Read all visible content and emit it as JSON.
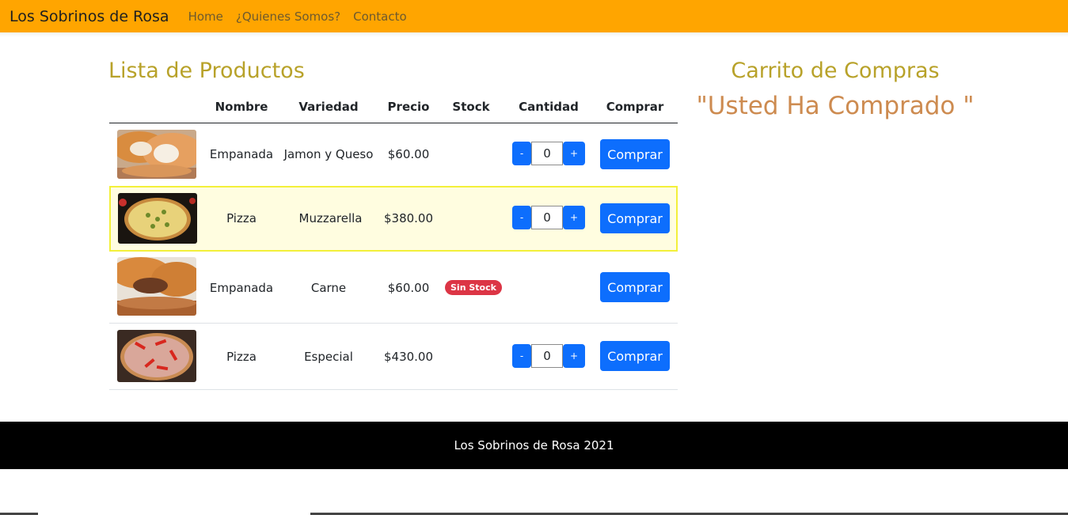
{
  "navbar": {
    "brand": "Los Sobrinos de Rosa",
    "links": [
      "Home",
      "¿Quienes Somos?",
      "Contacto"
    ]
  },
  "products": {
    "title": "Lista de Productos",
    "headers": [
      "Nombre",
      "Variedad",
      "Precio",
      "Stock",
      "Cantidad",
      "Comprar"
    ],
    "rows": [
      {
        "nombre": "Empanada",
        "variedad": "Jamon y Queso",
        "precio": "$60.00",
        "stock": "",
        "cantidad": "0",
        "comprar": "Comprar",
        "image": "empanada-jamon-queso-image"
      },
      {
        "nombre": "Pizza",
        "variedad": "Muzzarella",
        "precio": "$380.00",
        "stock": "",
        "cantidad": "0",
        "comprar": "Comprar",
        "image": "pizza-muzzarella-image"
      },
      {
        "nombre": "Empanada",
        "variedad": "Carne",
        "precio": "$60.00",
        "stock": "Sin Stock",
        "cantidad": "",
        "comprar": "Comprar",
        "image": "empanada-carne-image"
      },
      {
        "nombre": "Pizza",
        "variedad": "Especial",
        "precio": "$430.00",
        "stock": "",
        "cantidad": "0",
        "comprar": "Comprar",
        "image": "pizza-especial-image"
      }
    ],
    "decrement_label": "-",
    "increment_label": "+"
  },
  "cart": {
    "title": "Carrito de Compras",
    "message": "\"Usted Ha Comprado \""
  },
  "footer": {
    "text": "Los Sobrinos de Rosa 2021"
  },
  "colors": {
    "navbar": "#ffa500",
    "title": "#b8a22a",
    "cart_message": "#cd8b50",
    "button": "#0d6efd",
    "badge": "#dc3545",
    "highlight_border": "#f3f03a"
  }
}
